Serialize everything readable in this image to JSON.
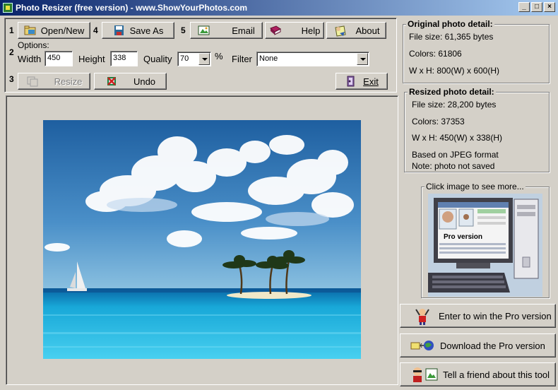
{
  "window": {
    "title": "Photo Resizer (free version)  - www.ShowYourPhotos.com"
  },
  "steps": {
    "s1": "1",
    "s2": "2",
    "s3": "3",
    "s4": "4",
    "s5": "5"
  },
  "toolbar": {
    "open_label": "Open/New",
    "saveas_label": "Save As",
    "email_label": "Email",
    "help_label": "Help",
    "about_label": "About",
    "resize_label": "Resize",
    "undo_label": "Undo",
    "exit_label": "Exit"
  },
  "options": {
    "header": "Options:",
    "width_label": "Width",
    "width_value": "450",
    "height_label": "Height",
    "height_value": "338",
    "quality_label": "Quality",
    "quality_value": "70",
    "percent": "%",
    "filter_label": "Filter",
    "filter_value": "None"
  },
  "original": {
    "title": "Original photo detail:",
    "file_size": "File size: 61,365 bytes",
    "colors": "Colors: 61806",
    "dims": "W x H: 800(W) x 600(H)"
  },
  "resized": {
    "title": "Resized photo detail:",
    "file_size": "File size: 28,200 bytes",
    "colors": "Colors: 37353",
    "dims": "W x H: 450(W) x 338(H)",
    "format": "Based on JPEG format",
    "note": "Note: photo not saved"
  },
  "promo": {
    "click_label": "Click image to see more...",
    "pro_label": "Pro version",
    "win_label": "Enter to win the Pro version",
    "download_label": "Download the Pro version",
    "tell_label": "Tell a friend about this tool"
  },
  "colors": {
    "title_start": "#0a246a",
    "title_end": "#a6caf0",
    "face": "#d4d0c8"
  }
}
